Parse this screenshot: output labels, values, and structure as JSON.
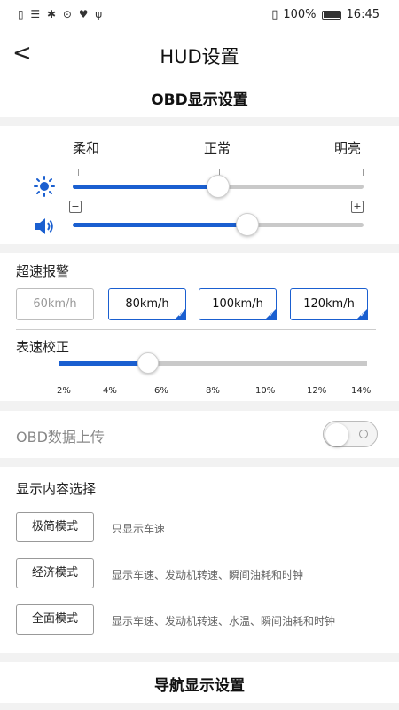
{
  "status_bar": {
    "left_icons": "▯ ☰ ✱ ⊙ ♥ ψ",
    "battery_text": "100%",
    "time": "16:45"
  },
  "header": {
    "back_symbol": "<",
    "title": "HUD设置"
  },
  "obd_section": {
    "title": "OBD显示设置"
  },
  "brightness": {
    "labels": [
      "柔和",
      "正常",
      "明亮"
    ],
    "brightness_level": 0.5,
    "volume_level": 0.6,
    "minus": "−",
    "plus": "+",
    "accent_color": "#1a5fd0"
  },
  "overspeed": {
    "label": "超速报警",
    "options": [
      "60km/h",
      "80km/h",
      "100km/h",
      "120km/h"
    ],
    "selected": [
      "80km/h",
      "100km/h",
      "120km/h"
    ],
    "check_mark": "✓"
  },
  "calibration": {
    "label": "表速校正",
    "ticks": [
      "2%",
      "4%",
      "6%",
      "8%",
      "10%",
      "12%",
      "14%"
    ],
    "level": 0.29
  },
  "upload": {
    "label": "OBD数据上传",
    "enabled": false
  },
  "display_content": {
    "label": "显示内容选择",
    "modes": [
      {
        "name": "极简模式",
        "desc": "只显示车速"
      },
      {
        "name": "经济模式",
        "desc": "显示车速、发动机转速、瞬间油耗和时钟"
      },
      {
        "name": "全面模式",
        "desc": "显示车速、发动机转速、水温、瞬间油耗和时钟"
      }
    ]
  },
  "nav_section": {
    "title": "导航显示设置"
  }
}
